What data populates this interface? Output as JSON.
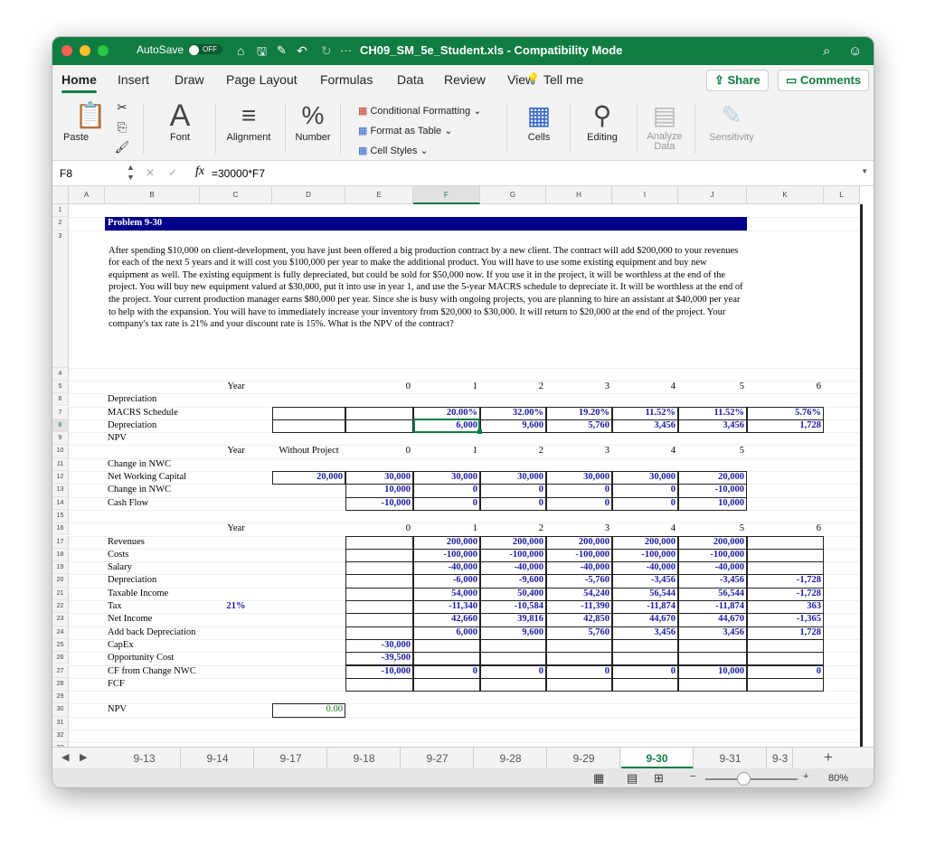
{
  "titlebar": {
    "autosave": "AutoSave",
    "autosave_state": "OFF",
    "title": "CH09_SM_5e_Student.xls  -  Compatibility Mode"
  },
  "ribbon_tabs": [
    "Home",
    "Insert",
    "Draw",
    "Page Layout",
    "Formulas",
    "Data",
    "Review",
    "View",
    "Tell me"
  ],
  "share": "Share",
  "comments": "Comments",
  "ribbon": {
    "paste": "Paste",
    "font": "Font",
    "alignment": "Alignment",
    "number": "Number",
    "conditional": "Conditional Formatting",
    "format_table": "Format as Table",
    "cell_styles": "Cell Styles",
    "cells": "Cells",
    "editing": "Editing",
    "analyze": "Analyze Data",
    "sensitivity": "Sensitivity"
  },
  "formula_bar": {
    "name_box": "F8",
    "fx": "fx",
    "formula": "=30000*F7"
  },
  "columns": [
    "A",
    "B",
    "C",
    "D",
    "E",
    "F",
    "G",
    "H",
    "I",
    "J",
    "K",
    "L"
  ],
  "selected_cell": "F8",
  "sheet": {
    "problem_title": "Problem 9-30",
    "problem_text": "After spending $10,000 on client-development, you have just been offered a big production contract by a new client.  The contract will add $200,000 to your revenues for each of the next 5 years and it will cost you $100,000 per year to make the additional product.  You will have to use some existing equipment and buy new equipment as well.  The existing equipment is fully depreciated, but could be sold for $50,000 now.  If you use it in the project, it will be worthless at the end of the project.  You will buy new equipment valued at $30,000, put it into use in year 1, and use the 5-year MACRS schedule to depreciate it. It will be worthless at the end of the project.  Your current production manager earns $80,000 per year.  Since she is busy with ongoing projects, you are planning to hire an assistant at $40,000 per year to help with the expansion.  You will have to immediately increase your inventory from $20,000 to $30,000. It will return to $20,000 at the end of the project. Your company's tax rate is 21% and your discount rate is 15%. What is the NPV of the contract?",
    "rows": {
      "5": {
        "C": "Year",
        "E": "0",
        "F": "1",
        "G": "2",
        "H": "3",
        "I": "4",
        "J": "5",
        "K": "6"
      },
      "6": {
        "B": "Depreciation"
      },
      "7": {
        "B": "MACRS Schedule",
        "F": "20.00%",
        "G": "32.00%",
        "H": "19.20%",
        "I": "11.52%",
        "J": "11.52%",
        "K": "5.76%"
      },
      "8": {
        "B": "Depreciation",
        "F": "6,000",
        "G": "9,600",
        "H": "5,760",
        "I": "3,456",
        "J": "3,456",
        "K": "1,728"
      },
      "9": {
        "B": "NPV"
      },
      "10": {
        "C": "Year",
        "D": "Without Project",
        "E": "0",
        "F": "1",
        "G": "2",
        "H": "3",
        "I": "4",
        "J": "5"
      },
      "11": {
        "B": "Change in NWC"
      },
      "12": {
        "B": "Net Working Capital",
        "D": "20,000",
        "E": "30,000",
        "F": "30,000",
        "G": "30,000",
        "H": "30,000",
        "I": "30,000",
        "J": "20,000"
      },
      "13": {
        "B": "Change in NWC",
        "E": "10,000",
        "F": "0",
        "G": "0",
        "H": "0",
        "I": "0",
        "J": "-10,000"
      },
      "14": {
        "B": "Cash Flow",
        "E": "-10,000",
        "F": "0",
        "G": "0",
        "H": "0",
        "I": "0",
        "J": "10,000"
      },
      "16": {
        "C": "Year",
        "E": "0",
        "F": "1",
        "G": "2",
        "H": "3",
        "I": "4",
        "J": "5",
        "K": "6"
      },
      "17": {
        "B": "Revenues",
        "F": "200,000",
        "G": "200,000",
        "H": "200,000",
        "I": "200,000",
        "J": "200,000"
      },
      "18": {
        "B": "Costs",
        "F": "-100,000",
        "G": "-100,000",
        "H": "-100,000",
        "I": "-100,000",
        "J": "-100,000"
      },
      "19": {
        "B": "Salary",
        "F": "-40,000",
        "G": "-40,000",
        "H": "-40,000",
        "I": "-40,000",
        "J": "-40,000"
      },
      "20": {
        "B": "Depreciation",
        "F": "-6,000",
        "G": "-9,600",
        "H": "-5,760",
        "I": "-3,456",
        "J": "-3,456",
        "K": "-1,728"
      },
      "21": {
        "B": "Taxable Income",
        "F": "54,000",
        "G": "50,400",
        "H": "54,240",
        "I": "56,544",
        "J": "56,544",
        "K": "-1,728"
      },
      "22": {
        "B": "Tax",
        "C": "21%",
        "F": "-11,340",
        "G": "-10,584",
        "H": "-11,390",
        "I": "-11,874",
        "J": "-11,874",
        "K": "363"
      },
      "23": {
        "B": "Net Income",
        "F": "42,660",
        "G": "39,816",
        "H": "42,850",
        "I": "44,670",
        "J": "44,670",
        "K": "-1,365"
      },
      "24": {
        "B": "Add back Depreciation",
        "F": "6,000",
        "G": "9,600",
        "H": "5,760",
        "I": "3,456",
        "J": "3,456",
        "K": "1,728"
      },
      "25": {
        "B": "CapEx",
        "E": "-30,000"
      },
      "26": {
        "B": "Opportunity Cost",
        "E": "-39,500"
      },
      "27": {
        "B": "CF from Change NWC",
        "E": "-10,000",
        "F": "0",
        "G": "0",
        "H": "0",
        "I": "0",
        "J": "10,000",
        "K": "0"
      },
      "28": {
        "B": "FCF"
      },
      "30": {
        "B": "NPV",
        "D": "0.00"
      }
    }
  },
  "sheet_tabs": [
    "9-13",
    "9-14",
    "9-17",
    "9-18",
    "9-27",
    "9-28",
    "9-29",
    "9-30",
    "9-31",
    "9-3"
  ],
  "active_sheet": "9-30",
  "zoom": "80%",
  "colors": {
    "accent": "#107c41",
    "value_blue": "#1a1aa6",
    "problem_bar": "#00008b",
    "npv_green": "#1a7a1a"
  }
}
